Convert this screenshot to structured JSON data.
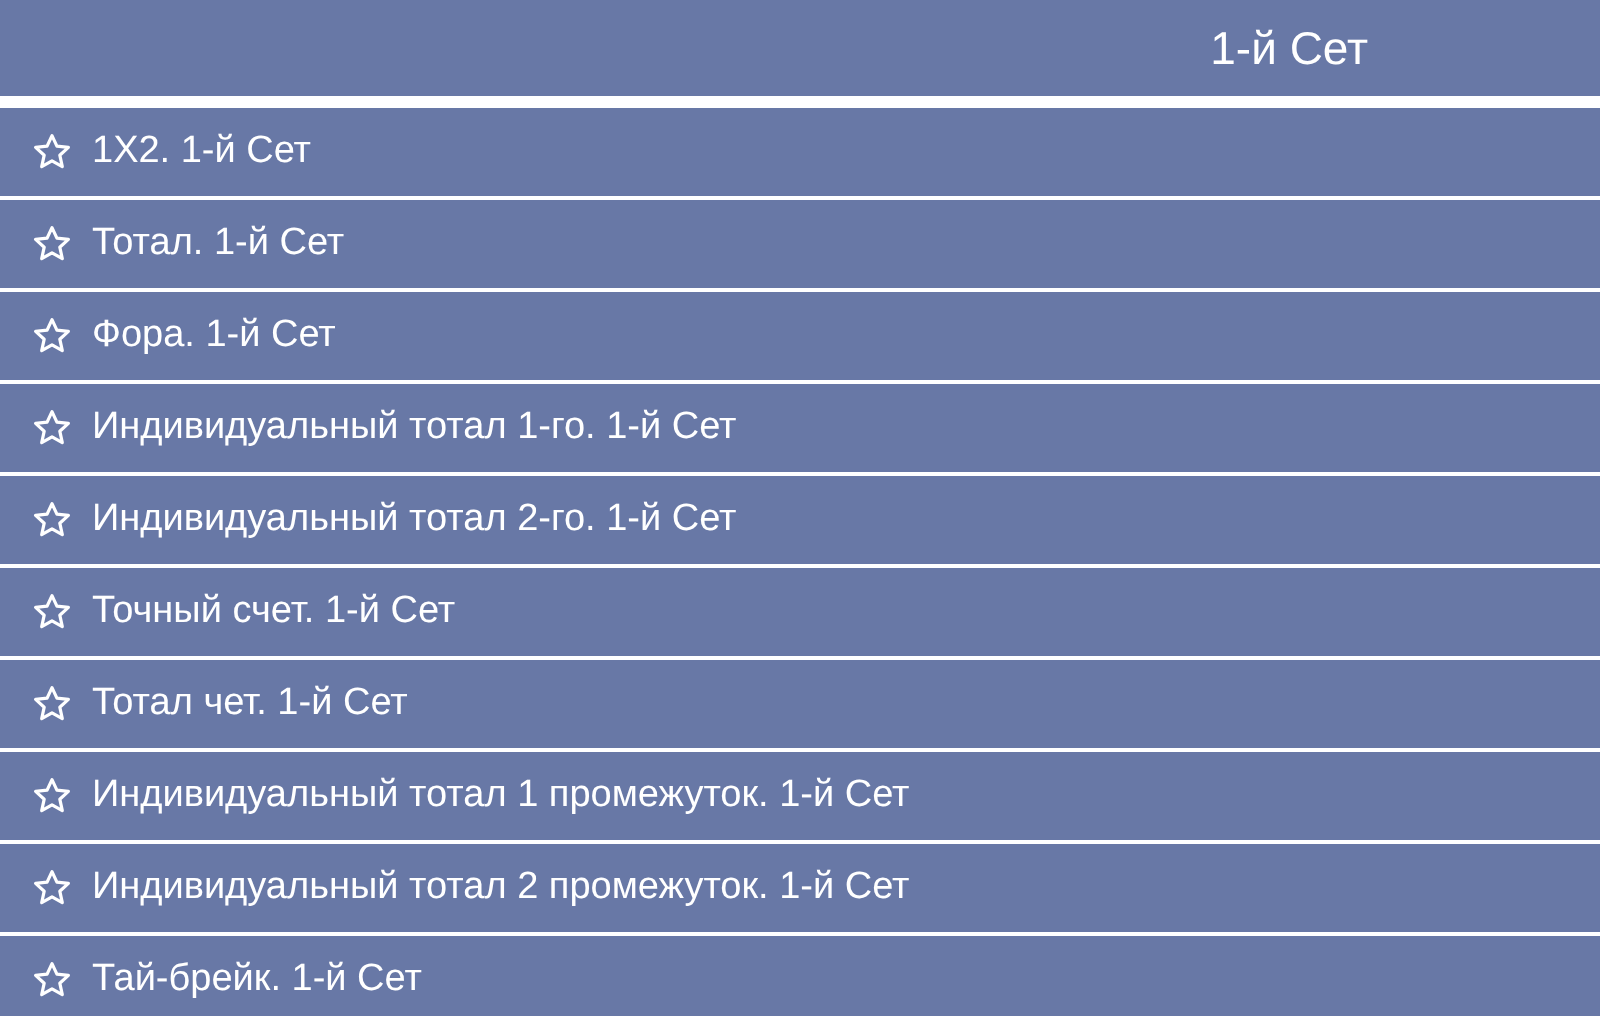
{
  "header": {
    "title": "1-й Сет"
  },
  "markets": [
    {
      "label": "1X2. 1-й Сет",
      "favorite": false
    },
    {
      "label": "Тотал. 1-й Сет",
      "favorite": false
    },
    {
      "label": "Фора. 1-й Сет",
      "favorite": false
    },
    {
      "label": "Индивидуальный тотал 1-го. 1-й Сет",
      "favorite": false
    },
    {
      "label": "Индивидуальный тотал 2-го. 1-й Сет",
      "favorite": false
    },
    {
      "label": "Точный счет. 1-й Сет",
      "favorite": false
    },
    {
      "label": "Тотал чет. 1-й Сет",
      "favorite": false
    },
    {
      "label": "Индивидуальный тотал 1 промежуток. 1-й Сет",
      "favorite": false
    },
    {
      "label": "Индивидуальный тотал 2 промежуток. 1-й Сет",
      "favorite": false
    },
    {
      "label": "Тай-брейк. 1-й Сет",
      "favorite": false
    }
  ]
}
